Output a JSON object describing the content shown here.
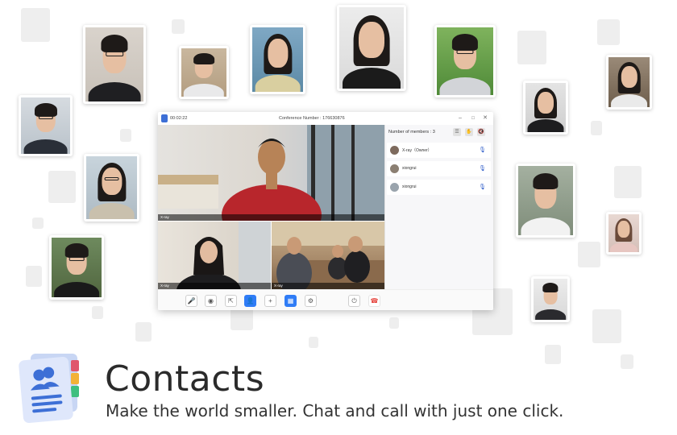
{
  "window": {
    "timer": "00:02:22",
    "conference_number": "Conference Number : 176630876",
    "controls": {
      "minimize": "–",
      "maximize": "□",
      "close": "✕"
    }
  },
  "videos": {
    "main": {
      "label": "X-ray"
    },
    "bottom_left": {
      "label": "X-ray"
    },
    "bottom_right": {
      "label": "X-ray"
    }
  },
  "members": {
    "header": "Number of members : 3",
    "items": [
      {
        "name": "X-ray（Owner）"
      },
      {
        "name": "xiongrui"
      },
      {
        "name": "xiongrui"
      }
    ]
  },
  "toolbar": {
    "icons": [
      "mic-icon",
      "camera-icon",
      "share-screen-icon",
      "members-icon",
      "invite-icon",
      "layout-icon",
      "settings-icon",
      "end-meeting-icon",
      "hangup-icon"
    ],
    "accent": "#2f7cf6",
    "hangup_color": "#e5413a"
  },
  "branding": {
    "headline": "Contacts",
    "tagline": "Make the world smaller. Chat and call with just one click.",
    "icon": "contacts-app-icon",
    "icon_color": "#3d6fd6"
  }
}
